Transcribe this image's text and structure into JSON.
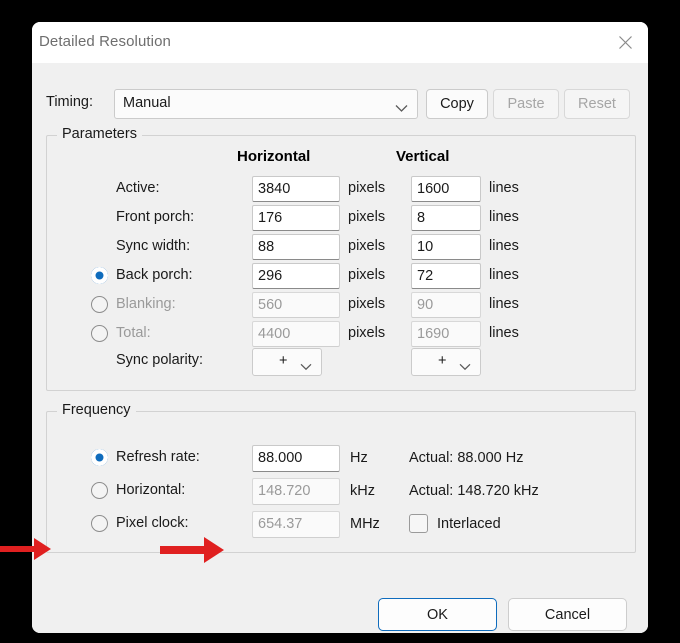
{
  "window": {
    "title": "Detailed Resolution",
    "close_icon": "close-icon"
  },
  "timing": {
    "label": "Timing:",
    "value": "Manual",
    "chevron_icon": "chevron-down-icon"
  },
  "toolbar": {
    "copy_label": "Copy",
    "paste_label": "Paste",
    "reset_label": "Reset"
  },
  "parameters": {
    "group_title": "Parameters",
    "col_horizontal": "Horizontal",
    "col_vertical": "Vertical",
    "unit_pixels": "pixels",
    "unit_lines": "lines",
    "rows": [
      {
        "label": "Active:",
        "h": "3840",
        "v": "1600",
        "radio": false,
        "selected": false,
        "disabled": false
      },
      {
        "label": "Front porch:",
        "h": "176",
        "v": "8",
        "radio": false,
        "selected": false,
        "disabled": false
      },
      {
        "label": "Sync width:",
        "h": "88",
        "v": "10",
        "radio": false,
        "selected": false,
        "disabled": false
      },
      {
        "label": "Back porch:",
        "h": "296",
        "v": "72",
        "radio": true,
        "selected": true,
        "disabled": false
      },
      {
        "label": "Blanking:",
        "h": "560",
        "v": "90",
        "radio": true,
        "selected": false,
        "disabled": true
      },
      {
        "label": "Total:",
        "h": "4400",
        "v": "1690",
        "radio": true,
        "selected": false,
        "disabled": true
      }
    ],
    "sync_polarity": {
      "label": "Sync polarity:",
      "horizontal_value": "+",
      "vertical_value": "+",
      "chevron_icon": "chevron-down-icon"
    }
  },
  "frequency": {
    "group_title": "Frequency",
    "rows": [
      {
        "label": "Refresh rate:",
        "value": "88.000",
        "unit": "Hz",
        "selected": true,
        "disabled": false,
        "actual": "Actual: 88.000 Hz"
      },
      {
        "label": "Horizontal:",
        "value": "148.720",
        "unit": "kHz",
        "selected": false,
        "disabled": true,
        "actual": "Actual: 148.720 kHz"
      },
      {
        "label": "Pixel clock:",
        "value": "654.37",
        "unit": "MHz",
        "selected": false,
        "disabled": true,
        "actual": ""
      }
    ],
    "interlaced": {
      "label": "Interlaced",
      "checked": false
    }
  },
  "footer": {
    "ok_label": "OK",
    "cancel_label": "Cancel"
  },
  "annotations": {
    "arrow_color": "#e02020",
    "arrows": [
      {
        "name": "arrow-pointing-to-pixel-clock-radio"
      },
      {
        "name": "arrow-pointing-to-pixel-clock-field"
      }
    ]
  },
  "colors": {
    "accent": "#0f6cbd",
    "dialog_bg": "#f0f0f0",
    "titlebar_bg": "#ffffff",
    "disabled_text": "#9a9a9a"
  }
}
